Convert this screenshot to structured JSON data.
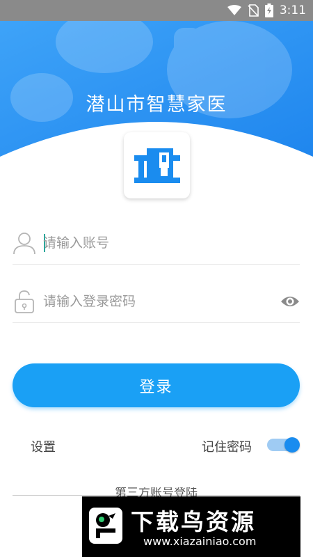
{
  "status_bar": {
    "time": "3:11",
    "icons": [
      "wifi-icon",
      "no-sim-icon",
      "battery-charging-icon"
    ]
  },
  "header": {
    "title": "潜山市智慧家医"
  },
  "form": {
    "account_placeholder": "请输入账号",
    "password_placeholder": "请输入登录密码"
  },
  "login_button_label": "登录",
  "options": {
    "settings_label": "设置",
    "remember_label": "记住密码",
    "remember_enabled": true
  },
  "third_party_label": "第三方账号登陆",
  "watermark": {
    "brand": "下载鸟资源",
    "url": "www.xiazainiao.com"
  },
  "colors": {
    "primary": "#1aa0f5",
    "header_blue": "#2a93f5",
    "toggle_on": "#1a8cef",
    "status_bar": "#8a8a8a"
  }
}
